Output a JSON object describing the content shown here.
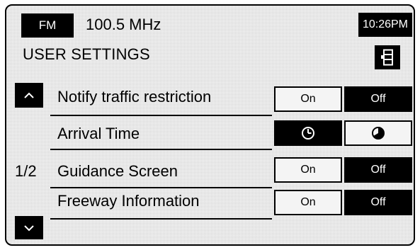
{
  "header": {
    "band": "FM",
    "frequency": "100.5 MHz",
    "time": "10:26PM"
  },
  "title": "USER SETTINGS",
  "page": "1/2",
  "rows": [
    {
      "label": "Notify traffic restriction",
      "on_label": "On",
      "off_label": "Off",
      "selected": "Off"
    },
    {
      "label": "Arrival Time",
      "left_icon": "clock-outline-icon",
      "right_icon": "clock-filled-icon",
      "selected": "left"
    },
    {
      "label": "Guidance Screen",
      "on_label": "On",
      "off_label": "Off",
      "selected": "Off"
    },
    {
      "label": "Freeway Information",
      "on_label": "On",
      "off_label": "Off",
      "selected": "Off"
    }
  ],
  "icons": {
    "menu": "settings-menu-icon",
    "scroll_up": "chevron-up-icon",
    "scroll_down": "chevron-down-icon"
  },
  "colors": {
    "selected": "#000000",
    "unselected": "#f4f4f4",
    "background": "#d2d2d2"
  }
}
